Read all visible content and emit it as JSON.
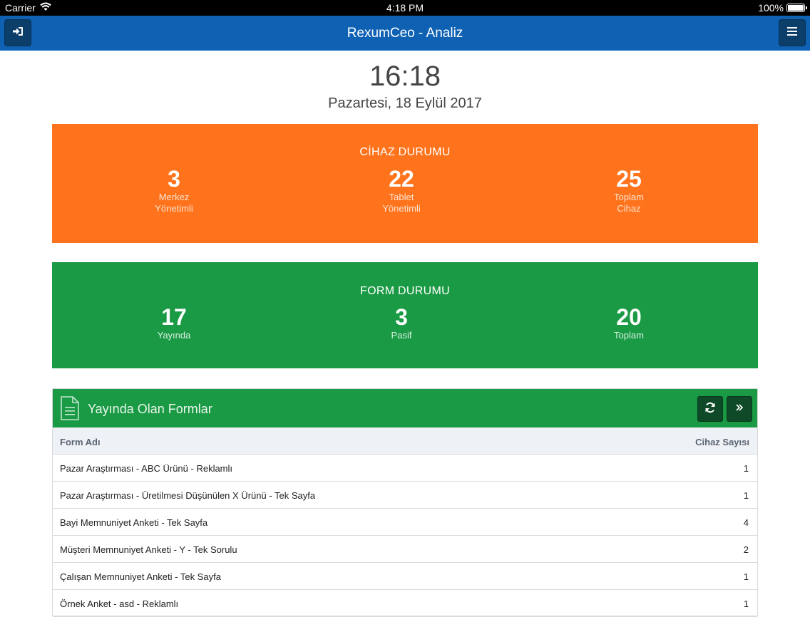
{
  "status_bar": {
    "carrier": "Carrier",
    "time": "4:18 PM",
    "battery": "100%"
  },
  "navbar": {
    "title": "RexumCeo - Analiz",
    "left_icon": "sign-in-icon",
    "right_icon": "hamburger-menu-icon"
  },
  "clock": {
    "time": "16:18",
    "date": "Pazartesi, 18 Eylül 2017"
  },
  "device_status": {
    "title": "CİHAZ DURUMU",
    "color": "#fe731b",
    "stats": [
      {
        "value": "3",
        "label_line1": "Merkez",
        "label_line2": "Yönetimli"
      },
      {
        "value": "22",
        "label_line1": "Tablet",
        "label_line2": "Yönetimli"
      },
      {
        "value": "25",
        "label_line1": "Toplam",
        "label_line2": "Cihaz"
      }
    ]
  },
  "form_status": {
    "title": "FORM DURUMU",
    "color": "#1b9a45",
    "stats": [
      {
        "value": "17",
        "label": "Yayında"
      },
      {
        "value": "3",
        "label": "Pasif"
      },
      {
        "value": "20",
        "label": "Toplam"
      }
    ]
  },
  "forms_card": {
    "title": "Yayında Olan Formlar",
    "icon": "document-icon",
    "refresh_icon": "refresh-icon",
    "forward_icon": "double-chevron-right-icon",
    "columns": [
      "Form Adı",
      "Cihaz Sayısı"
    ],
    "rows": [
      {
        "name": "Pazar Araştırması - ABC Ürünü - Reklamlı",
        "count": "1"
      },
      {
        "name": "Pazar Araştırması - Üretilmesi Düşünülen X Ürünü - Tek Sayfa",
        "count": "1"
      },
      {
        "name": "Bayi Memnuniyet Anketi - Tek Sayfa",
        "count": "4"
      },
      {
        "name": "Müşteri Memnuniyet Anketi - Y - Tek Sorulu",
        "count": "2"
      },
      {
        "name": "Çalışan Memnuniyet Anketi - Tek Sayfa",
        "count": "1"
      },
      {
        "name": "Örnek Anket - asd - Reklamlı",
        "count": "1"
      }
    ]
  }
}
